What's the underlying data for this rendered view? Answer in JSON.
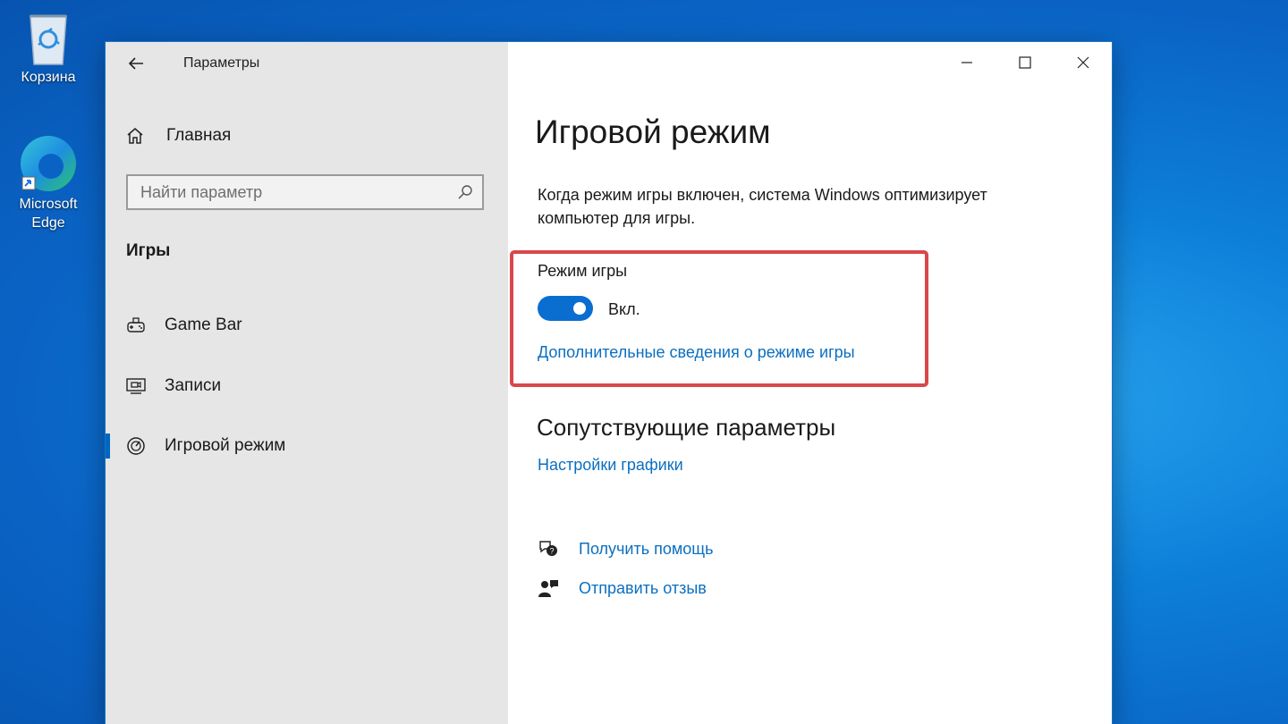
{
  "desktop": {
    "icons": [
      {
        "label": "Корзина",
        "icon": "recycle-bin-icon"
      },
      {
        "label": "Microsoft Edge",
        "icon": "edge-icon"
      }
    ]
  },
  "window": {
    "app_title": "Параметры",
    "controls": {
      "minimize": "minimize-icon",
      "maximize": "maximize-icon",
      "close": "close-icon"
    }
  },
  "sidebar": {
    "home_label": "Главная",
    "search": {
      "placeholder": "Найти параметр",
      "value": ""
    },
    "section_title": "Игры",
    "items": [
      {
        "label": "Game Bar",
        "icon": "game-bar-icon",
        "active": false
      },
      {
        "label": "Записи",
        "icon": "captures-icon",
        "active": false
      },
      {
        "label": "Игровой режим",
        "icon": "game-mode-icon",
        "active": true
      }
    ]
  },
  "main": {
    "title": "Игровой режим",
    "description": "Когда режим игры включен, система Windows оптимизирует компьютер для игры.",
    "game_mode": {
      "label": "Режим игры",
      "toggle_on": true,
      "state_label": "Вкл.",
      "more_info_link": "Дополнительные сведения о режиме игры"
    },
    "related": {
      "title": "Сопутствующие параметры",
      "graphics_link": "Настройки графики"
    },
    "help": {
      "get_help": "Получить помощь",
      "feedback": "Отправить отзыв"
    }
  },
  "colors": {
    "accent": "#0a6ed1",
    "link": "#0b6fc0",
    "highlight_border": "#d9474b",
    "sidebar_bg": "#e6e6e6"
  }
}
